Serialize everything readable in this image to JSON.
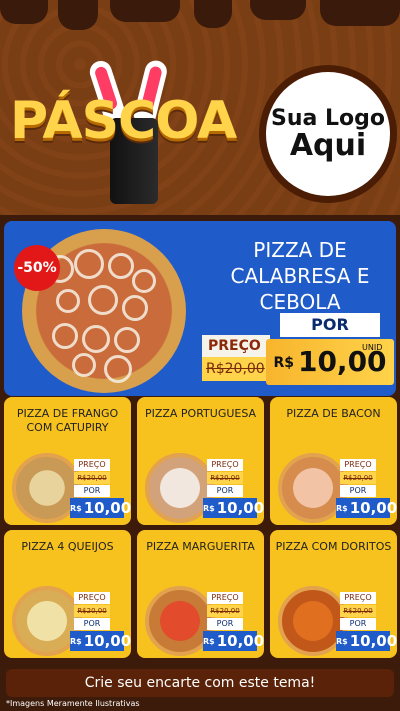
{
  "hero": {
    "title": "PÁSCOA",
    "logo_line1": "Sua Logo",
    "logo_line2": "Aqui"
  },
  "featured": {
    "discount": "-50%",
    "name": "PIZZA DE CALABRESA E CEBOLA",
    "preco_label": "PREÇO",
    "por_label": "POR",
    "old_price": "R$20,00",
    "new_price_currency": "R$",
    "new_price": "10,00",
    "unid": "UNID"
  },
  "cards": [
    {
      "name": "PIZZA DE FRANGO COM CATUPIRY",
      "preco": "PREÇO",
      "old": "R$20,00",
      "por": "POR",
      "price": "10,00",
      "currency": "R$",
      "unid": "UNID"
    },
    {
      "name": "PIZZA PORTUGUESA",
      "preco": "PREÇO",
      "old": "R$20,00",
      "por": "POR",
      "price": "10,00",
      "currency": "R$",
      "unid": "UNID"
    },
    {
      "name": "PIZZA DE BACON",
      "preco": "PREÇO",
      "old": "R$20,00",
      "por": "POR",
      "price": "10,00",
      "currency": "R$",
      "unid": "UNID"
    },
    {
      "name": "PIZZA 4 QUEIJOS",
      "preco": "PREÇO",
      "old": "R$20,00",
      "por": "POR",
      "price": "10,00",
      "currency": "R$",
      "unid": "UNID"
    },
    {
      "name": "PIZZA MARGUERITA",
      "preco": "PREÇO",
      "old": "R$20,00",
      "por": "POR",
      "price": "10,00",
      "currency": "R$",
      "unid": "UNID"
    },
    {
      "name": "PIZZA COM DORITOS",
      "preco": "PREÇO",
      "old": "R$20,00",
      "por": "POR",
      "price": "10,00",
      "currency": "R$",
      "unid": "UNID"
    }
  ],
  "cta": "Crie seu encarte com este tema!",
  "disclaimer": "*Imagens Meramente Ilustrativas",
  "colors": {
    "brown": "#7a3e14",
    "blue": "#1f5bc9",
    "yellow": "#f7c21e",
    "red": "#e21818"
  }
}
